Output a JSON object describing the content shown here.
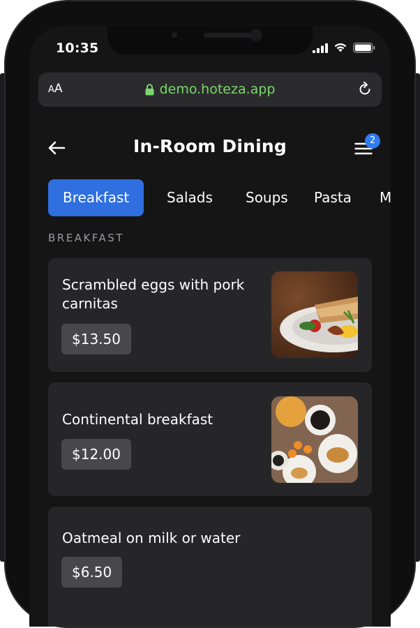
{
  "status_bar": {
    "time": "10:35"
  },
  "browser": {
    "text_size_label_small": "A",
    "text_size_label_large": "A",
    "url": "demo.hoteza.app"
  },
  "header": {
    "title": "In-Room Dining",
    "cart_count": "2"
  },
  "tabs": [
    {
      "label": "Breakfast",
      "active": true
    },
    {
      "label": "Salads"
    },
    {
      "label": "Soups"
    },
    {
      "label": "Pasta"
    },
    {
      "label": "M"
    }
  ],
  "section": {
    "title": "BREAKFAST"
  },
  "items": [
    {
      "name": "Scrambled eggs with pork carnitas",
      "price": "$13.50",
      "image": "scrambled-eggs-photo"
    },
    {
      "name": "Continental breakfast",
      "price": "$12.00",
      "image": "continental-breakfast-photo"
    },
    {
      "name": "Oatmeal on milk or water",
      "price": "$6.50"
    }
  ],
  "colors": {
    "accent": "#2f6fe0",
    "badge": "#2f7df2",
    "url_green": "#7ad86b",
    "card_bg": "#262628",
    "screen_bg": "#151516"
  }
}
